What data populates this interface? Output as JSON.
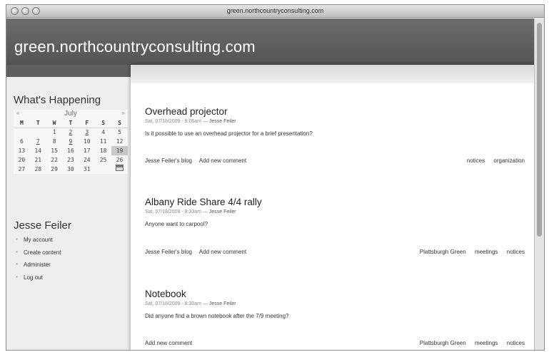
{
  "window": {
    "title": "green.northcountryconsulting.com"
  },
  "site": {
    "name": "green.northcountryconsulting.com"
  },
  "sidebar": {
    "whats_happening": "What's Happening",
    "calendar": {
      "month": "July",
      "prev": "«",
      "next": "»",
      "weekdays": [
        "M",
        "T",
        "W",
        "T",
        "F",
        "S",
        "S"
      ],
      "weeks": [
        [
          "",
          "",
          "1",
          "2",
          "3",
          "4",
          "5"
        ],
        [
          "6",
          "7",
          "8",
          "9",
          "10",
          "11",
          "12"
        ],
        [
          "13",
          "14",
          "15",
          "16",
          "17",
          "18",
          "19"
        ],
        [
          "20",
          "21",
          "22",
          "23",
          "24",
          "25",
          "26"
        ],
        [
          "27",
          "28",
          "29",
          "30",
          "31",
          "",
          ""
        ]
      ]
    },
    "user": {
      "name": "Jesse Feiler",
      "links": [
        "My account",
        "Create content",
        "Administer",
        "Log out"
      ]
    }
  },
  "nodes": [
    {
      "title": "Overhead projector",
      "date": "Sat, 07/18/2009 - 9:06am —",
      "author": "Jesse Feiler",
      "body": "Is it possible to use an overhead projector for a brief presentation?",
      "links": [
        "Jesse Feiler's blog",
        "Add new comment"
      ],
      "tags": [
        "notices",
        "organization"
      ]
    },
    {
      "title": "Albany Ride Share 4/4 rally",
      "date": "Sat, 07/18/2009 - 8:33am —",
      "author": "Jesse Feiler",
      "body": "Anyone want to carpool?",
      "links": [
        "Jesse Feiler's blog",
        "Add new comment"
      ],
      "tags": [
        "Plattsburgh Green",
        "meetings",
        "notices"
      ]
    },
    {
      "title": "Notebook",
      "date": "Sat, 07/18/2009 - 8:30am —",
      "author": "Jesse Feiler",
      "body": "Did anyone find a brown notebook after the 7/9 meeting?",
      "links": [
        "Add new comment"
      ],
      "tags": [
        "Plattsburgh Green",
        "meetings",
        "notices"
      ]
    }
  ]
}
